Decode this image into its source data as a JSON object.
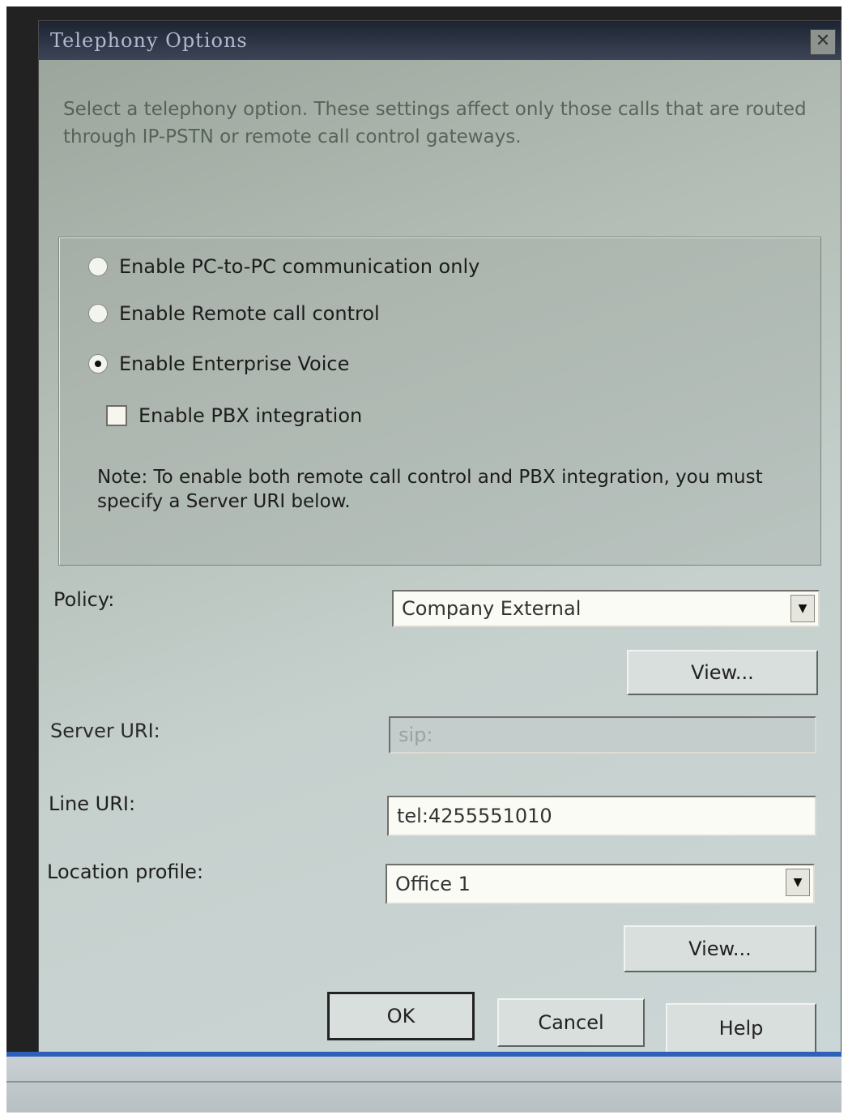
{
  "dialog": {
    "title": "Telephony Options",
    "close_glyph": "✕",
    "description": "Select a telephony option. These settings affect only those calls that are routed through IP-PSTN or remote call control gateways."
  },
  "options": {
    "radio_pc_to_pc": {
      "label": "Enable PC-to-PC communication only",
      "checked": false
    },
    "radio_remote_call": {
      "label": "Enable Remote call control",
      "checked": false
    },
    "radio_enterprise_voice": {
      "label": "Enable Enterprise Voice",
      "checked": true
    },
    "checkbox_pbx": {
      "label": "Enable PBX integration",
      "checked": false
    },
    "note": "Note: To enable both remote call control and PBX integration, you must specify a Server URI below."
  },
  "policy": {
    "label": "Policy:",
    "value": "Company External",
    "view_label": "View..."
  },
  "server_uri": {
    "label": "Server URI:",
    "value": "sip:"
  },
  "line_uri": {
    "label": "Line URI:",
    "value": "tel:4255551010"
  },
  "location_profile": {
    "label": "Location profile:",
    "value": "Office 1",
    "view_label": "View..."
  },
  "buttons": {
    "ok": "OK",
    "cancel": "Cancel",
    "help": "Help"
  },
  "icons": {
    "dropdown_arrow": "▼"
  },
  "colors": {
    "titlebar": "#1d2330",
    "taskbar_accent": "#2e5fb9"
  }
}
